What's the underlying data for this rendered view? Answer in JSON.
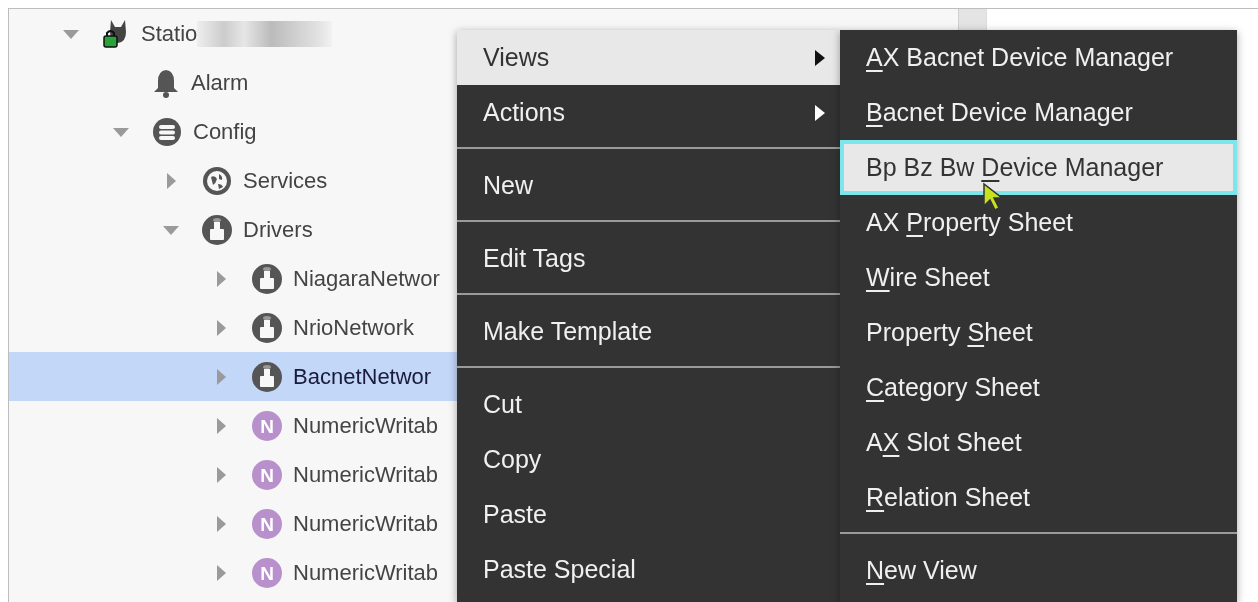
{
  "tree": [
    {
      "label": "Statio",
      "kind": "station",
      "expanded": true,
      "selected": false,
      "redacted": true,
      "children": [
        {
          "label": "Alarm",
          "kind": "alarm",
          "selected": false
        },
        {
          "label": "Config",
          "kind": "database",
          "expanded": true,
          "selected": false,
          "children": [
            {
              "label": "Services",
              "kind": "services",
              "expanded": false,
              "selected": false
            },
            {
              "label": "Drivers",
              "kind": "driver",
              "expanded": true,
              "selected": false,
              "children": [
                {
                  "label": "NiagaraNetwor",
                  "kind": "driver",
                  "expanded": false,
                  "selected": false
                },
                {
                  "label": "NrioNetwork",
                  "kind": "driver",
                  "expanded": false,
                  "selected": false
                },
                {
                  "label": "BacnetNetwor",
                  "kind": "driver",
                  "expanded": false,
                  "selected": true
                },
                {
                  "label": "NumericWritab",
                  "kind": "numeric",
                  "icon_letter": "N",
                  "expanded": false,
                  "selected": false
                },
                {
                  "label": "NumericWritab",
                  "kind": "numeric",
                  "icon_letter": "N",
                  "expanded": false,
                  "selected": false
                },
                {
                  "label": "NumericWritab",
                  "kind": "numeric",
                  "icon_letter": "N",
                  "expanded": false,
                  "selected": false
                },
                {
                  "label": "NumericWritab",
                  "kind": "numeric",
                  "icon_letter": "N",
                  "expanded": false,
                  "selected": false
                }
              ]
            }
          ]
        }
      ]
    }
  ],
  "context_menu": [
    {
      "kind": "item",
      "label": "Views",
      "submenu": true,
      "highlighted": true
    },
    {
      "kind": "item",
      "label": "Actions",
      "submenu": true,
      "highlighted": false
    },
    {
      "kind": "separator"
    },
    {
      "kind": "item",
      "label": "New",
      "submenu": false,
      "highlighted": false
    },
    {
      "kind": "separator"
    },
    {
      "kind": "item",
      "label": "Edit Tags",
      "submenu": false,
      "highlighted": false
    },
    {
      "kind": "separator"
    },
    {
      "kind": "item",
      "label": "Make Template",
      "submenu": false,
      "highlighted": false
    },
    {
      "kind": "separator"
    },
    {
      "kind": "item",
      "label": "Cut",
      "submenu": false,
      "highlighted": false
    },
    {
      "kind": "item",
      "label": "Copy",
      "submenu": false,
      "highlighted": false
    },
    {
      "kind": "item",
      "label": "Paste",
      "submenu": false,
      "highlighted": false
    },
    {
      "kind": "item",
      "label": "Paste Special",
      "submenu": false,
      "highlighted": false
    }
  ],
  "views_submenu": [
    {
      "kind": "item",
      "key": "A",
      "post": "X Bacnet Device Manager",
      "highlighted": false
    },
    {
      "kind": "item",
      "key": "B",
      "post": "acnet Device Manager",
      "highlighted": false
    },
    {
      "kind": "item",
      "pre": "Bp Bz Bw ",
      "key": "D",
      "post": "evice Manager",
      "highlighted": true
    },
    {
      "kind": "item",
      "pre": "AX ",
      "key": "P",
      "post": "roperty Sheet",
      "highlighted": false
    },
    {
      "kind": "item",
      "key": "W",
      "post": "ire Sheet",
      "highlighted": false
    },
    {
      "kind": "item",
      "pre": "Property ",
      "key": "S",
      "post": "heet",
      "highlighted": false
    },
    {
      "kind": "item",
      "key": "C",
      "post": "ategory Sheet",
      "highlighted": false
    },
    {
      "kind": "item",
      "pre": "A",
      "key": "X",
      "post": " Slot Sheet",
      "highlighted": false
    },
    {
      "kind": "item",
      "key": "R",
      "post": "elation Sheet",
      "highlighted": false
    },
    {
      "kind": "separator"
    },
    {
      "kind": "item",
      "key": "N",
      "post": "ew View",
      "highlighted": false
    }
  ]
}
